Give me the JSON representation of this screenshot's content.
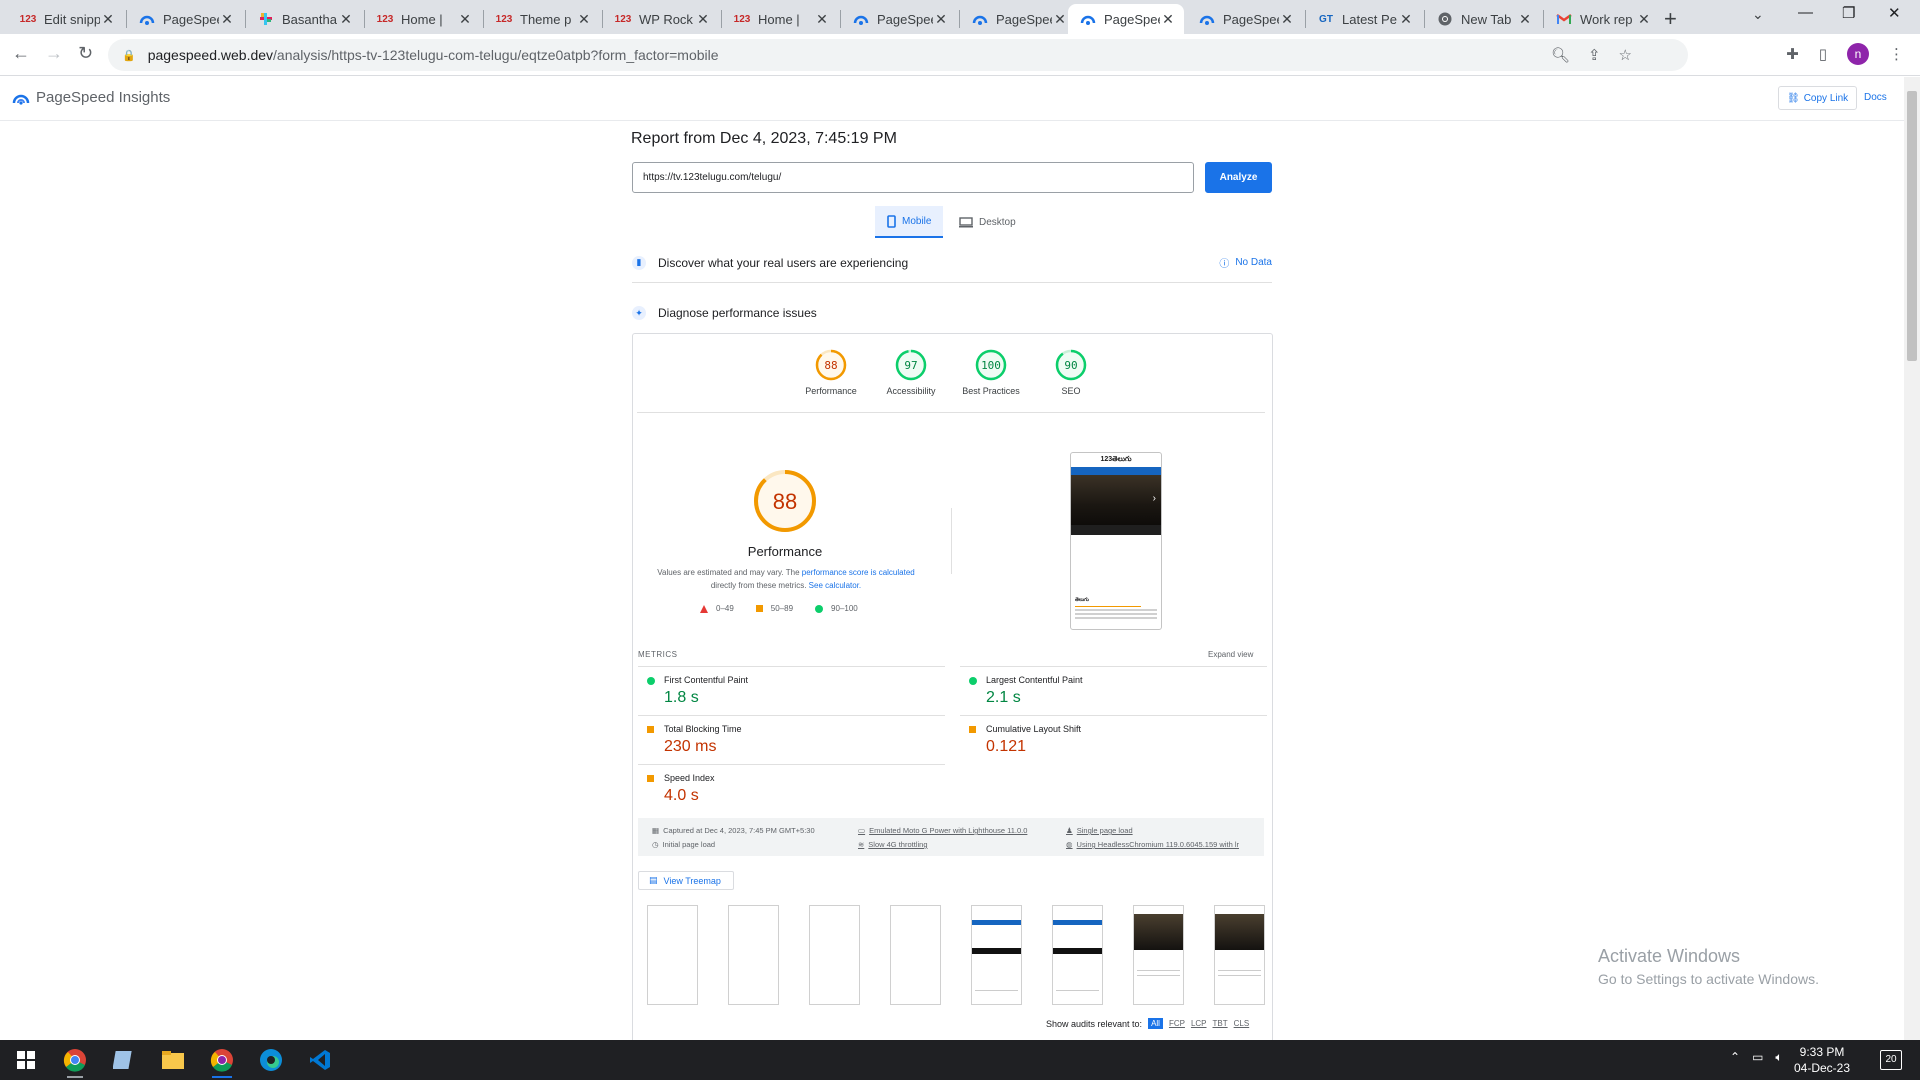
{
  "browser": {
    "tabs": [
      {
        "title": "Edit snipp",
        "favicon": "123"
      },
      {
        "title": "PageSpee",
        "favicon": "pagespeed"
      },
      {
        "title": "Basantha",
        "favicon": "slack"
      },
      {
        "title": "Home |",
        "favicon": "123"
      },
      {
        "title": "Theme p",
        "favicon": "123"
      },
      {
        "title": "WP Rock",
        "favicon": "123"
      },
      {
        "title": "Home |",
        "favicon": "123"
      },
      {
        "title": "PageSpee",
        "favicon": "pagespeed"
      },
      {
        "title": "PageSpee",
        "favicon": "pagespeed"
      },
      {
        "title": "PageSpee",
        "favicon": "pagespeed",
        "active": true
      },
      {
        "title": "PageSpee",
        "favicon": "pagespeed"
      },
      {
        "title": "Latest Pe",
        "favicon": "GT"
      },
      {
        "title": "New Tab",
        "favicon": "chrome"
      },
      {
        "title": "Work rep",
        "favicon": "gmail"
      }
    ],
    "url_host": "pagespeed.web.dev",
    "url_path": "/analysis/https-tv-123telugu-com-telugu/eqtze0atpb?form_factor=mobile",
    "profile_initial": "n"
  },
  "psi": {
    "brand": "PageSpeed Insights",
    "copy_link": "Copy Link",
    "docs": "Docs",
    "report_title": "Report from Dec 4, 2023, 7:45:19 PM",
    "url_value": "https://tv.123telugu.com/telugu/",
    "analyze": "Analyze",
    "mobile_tab": "Mobile",
    "desktop_tab": "Desktop",
    "discover": "Discover what your real users are experiencing",
    "no_data": "No Data",
    "diagnose": "Diagnose performance issues",
    "categories": [
      {
        "label": "Performance",
        "score": 88,
        "color": "#f29900"
      },
      {
        "label": "Accessibility",
        "score": 97,
        "color": "#0cce6b"
      },
      {
        "label": "Best Practices",
        "score": 100,
        "color": "#0cce6b"
      },
      {
        "label": "SEO",
        "score": 90,
        "color": "#0cce6b"
      }
    ],
    "perf_score": 88,
    "perf_label": "Performance",
    "note_pre": "Values are estimated and may vary. The",
    "note_link1": "performance score is calculated",
    "note_mid": "directly from these metrics.",
    "note_link2": "See calculator.",
    "legend": {
      "bad": "0–49",
      "avg": "50–89",
      "good": "90–100"
    },
    "phone_logo": "123తెలుగు",
    "phone_heading": "తెలుగు",
    "metrics_header": "METRICS",
    "expand_view": "Expand view",
    "metrics": [
      {
        "name": "First Contentful Paint",
        "value": "1.8 s",
        "rating": "good"
      },
      {
        "name": "Largest Contentful Paint",
        "value": "2.1 s",
        "rating": "good"
      },
      {
        "name": "Total Blocking Time",
        "value": "230 ms",
        "rating": "average"
      },
      {
        "name": "Cumulative Layout Shift",
        "value": "0.121",
        "rating": "average"
      },
      {
        "name": "Speed Index",
        "value": "4.0 s",
        "rating": "average"
      }
    ],
    "info": {
      "captured": "Captured at Dec 4, 2023, 7:45 PM GMT+5:30",
      "initial": "Initial page load",
      "device": "Emulated Moto G Power with Lighthouse 11.0.0",
      "throttle": "Slow 4G throttling",
      "session": "Single page load",
      "browser": "Using HeadlessChromium 119.0.6045.159 with lr"
    },
    "view_treemap": "View Treemap",
    "show_audits_label": "Show audits relevant to:",
    "audit_chips": [
      "All",
      "FCP",
      "LCP",
      "TBT",
      "CLS"
    ]
  },
  "watermark": {
    "line1": "Activate Windows",
    "line2": "Go to Settings to activate Windows."
  },
  "taskbar": {
    "time": "9:33 PM",
    "date": "04-Dec-23",
    "notifications": "20"
  }
}
